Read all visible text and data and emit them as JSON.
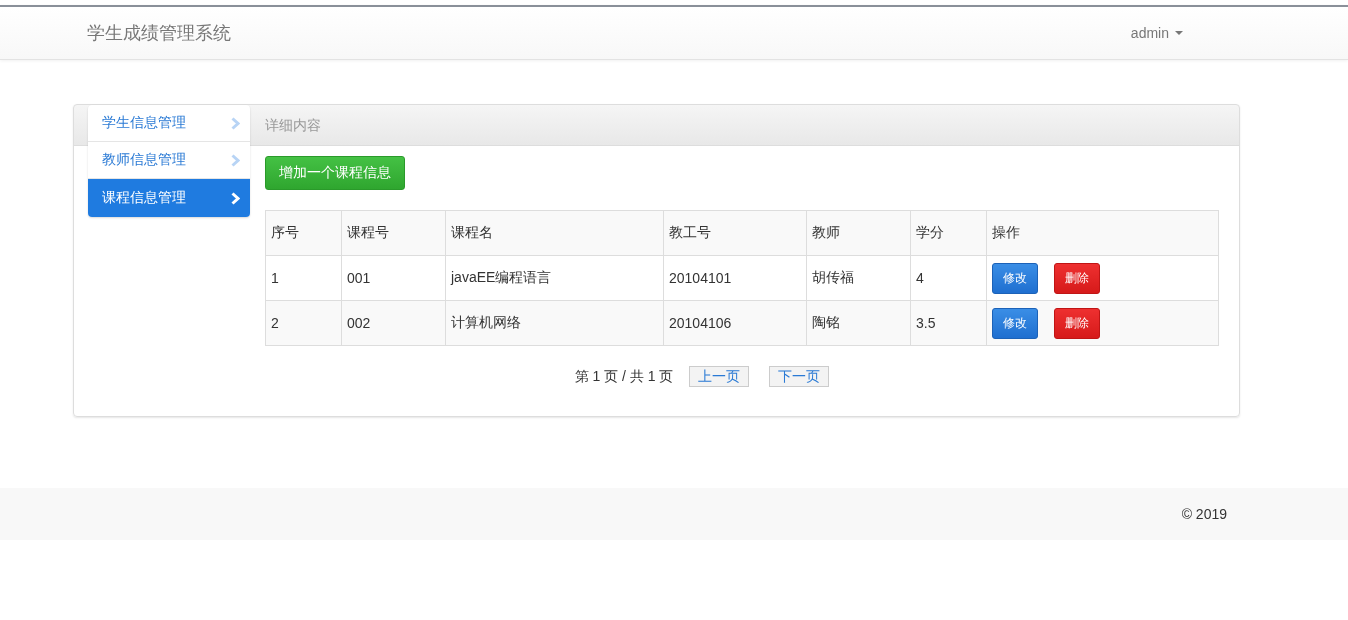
{
  "navbar": {
    "brand": "学生成绩管理系统",
    "user": "admin"
  },
  "sidebar": {
    "items": [
      {
        "label": "学生信息管理",
        "selected": false
      },
      {
        "label": "教师信息管理",
        "selected": false
      },
      {
        "label": "课程信息管理",
        "selected": true
      }
    ]
  },
  "panel": {
    "heading": "详细内容",
    "add_button": "增加一个课程信息"
  },
  "table": {
    "columns": [
      "序号",
      "课程号",
      "课程名",
      "教工号",
      "教师",
      "学分",
      "操作"
    ],
    "rows": [
      {
        "cells": [
          "1",
          "001",
          "javaEE编程语言",
          "20104101",
          "胡传福",
          "4"
        ],
        "edit": "修改",
        "delete": "删除"
      },
      {
        "cells": [
          "2",
          "002",
          "计算机网络",
          "20104106",
          "陶铭",
          "3.5"
        ],
        "edit": "修改",
        "delete": "删除"
      }
    ]
  },
  "pagination": {
    "info": "第 1 页 / 共 1 页",
    "prev": "上一页",
    "next": "下一页"
  },
  "footer": {
    "copyright": "© 2019"
  }
}
